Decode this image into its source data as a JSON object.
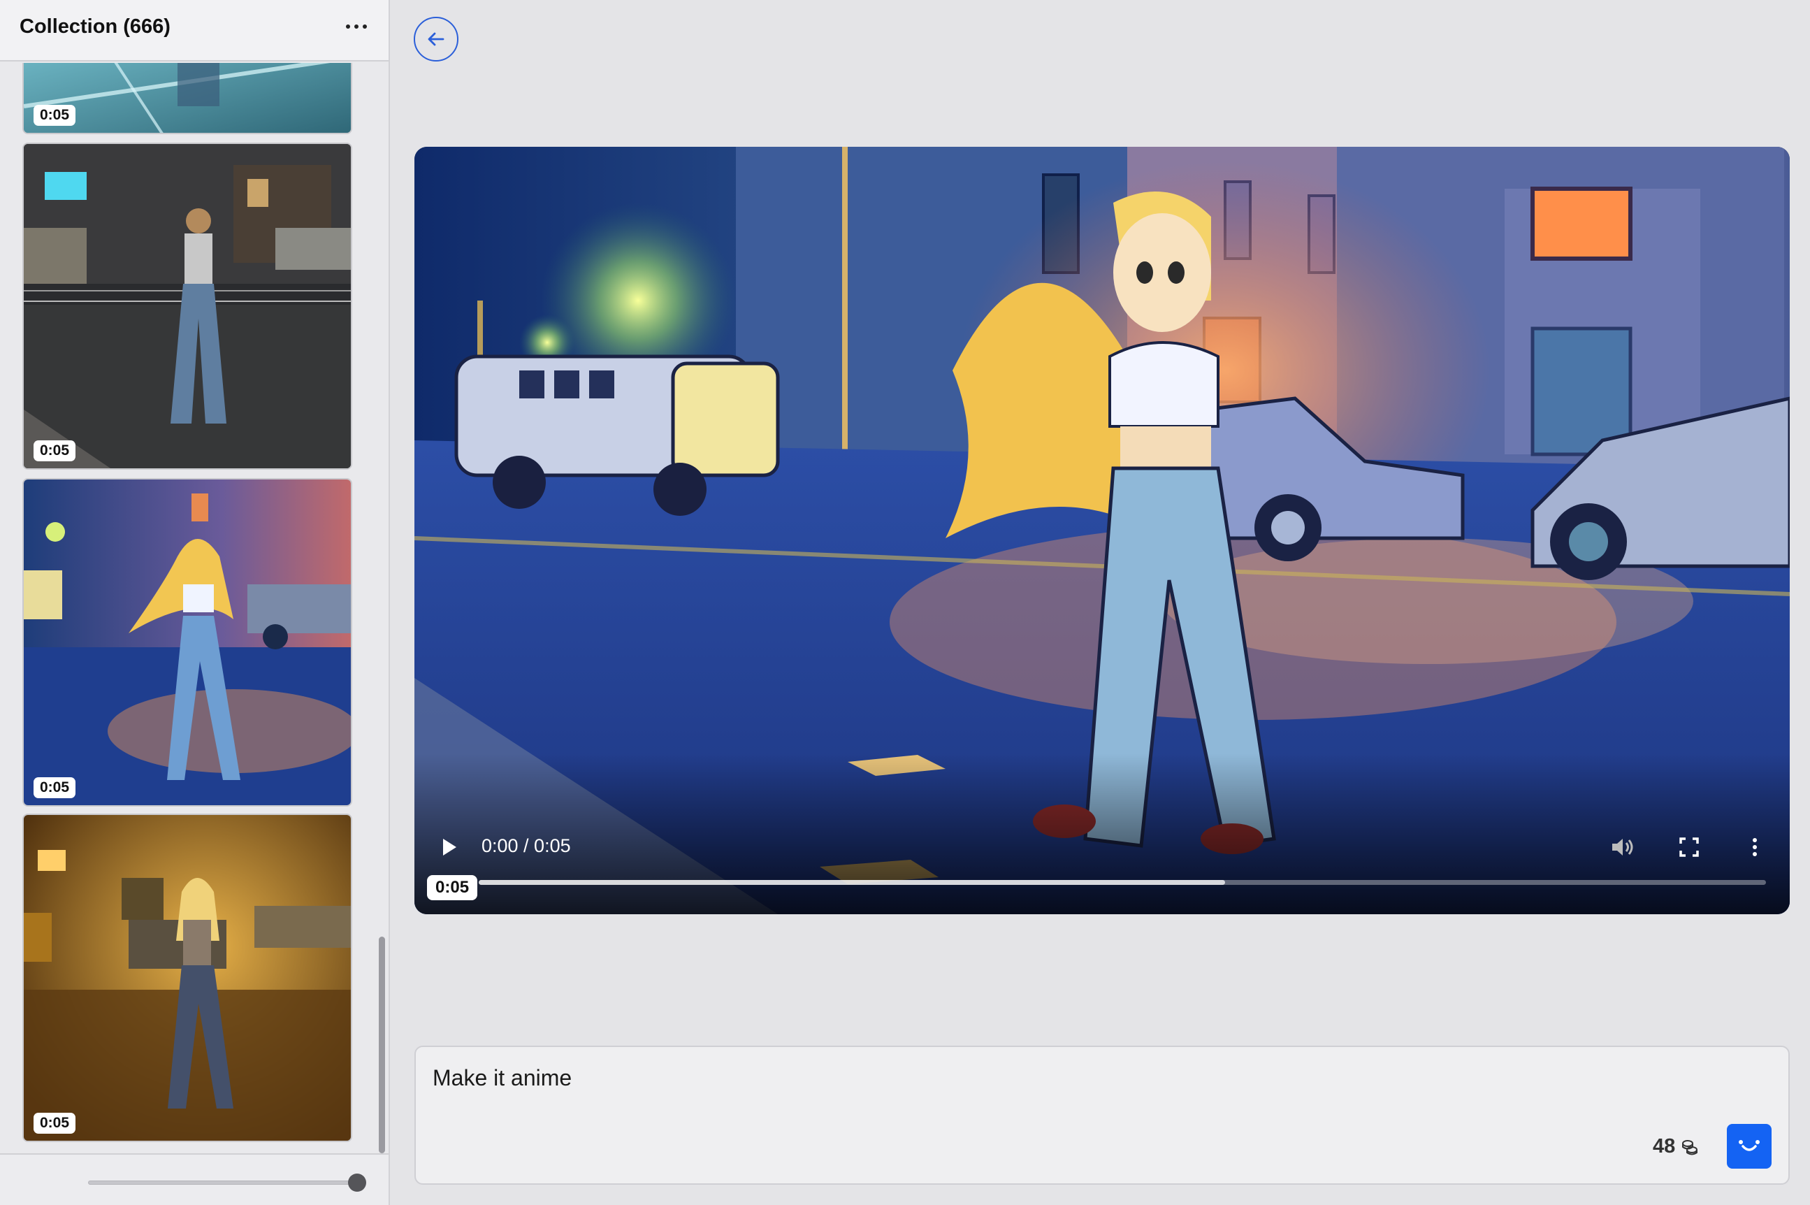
{
  "sidebar": {
    "title": "Collection (666)",
    "more_icon": "ellipsis-icon",
    "thumbnails": [
      {
        "duration": "0:05",
        "style": "cyan-glass"
      },
      {
        "duration": "0:05",
        "style": "night-street-photo"
      },
      {
        "duration": "0:05",
        "style": "anime"
      },
      {
        "duration": "0:05",
        "style": "golden-glow"
      }
    ],
    "thumbnail_size_slider_fraction": 0.97
  },
  "back_icon": "arrow-left-icon",
  "player": {
    "time_display": "0:00 / 0:05",
    "duration_badge": "0:05",
    "buffered_fraction": 0.58,
    "played_fraction": 0,
    "icons": [
      "play-icon",
      "volume-icon",
      "fullscreen-icon",
      "kebab-menu-icon"
    ]
  },
  "prompt": {
    "text": "Make it anime",
    "credits": "48",
    "credits_icon": "coins-icon",
    "submit_icon": "smile-icon"
  },
  "colors": {
    "accent": "#1463f3",
    "back_ring": "#2b5fd9"
  }
}
